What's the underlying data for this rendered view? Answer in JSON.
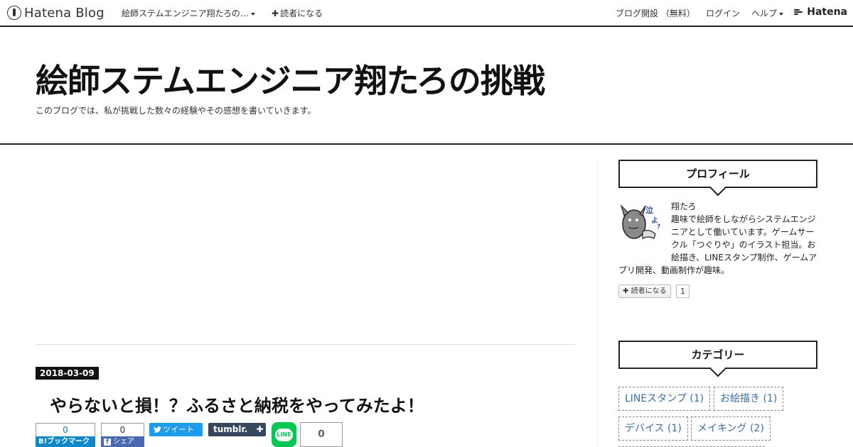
{
  "global_header": {
    "logo_text": "Hatena Blog",
    "blog_menu": "絵師ステムエンジニア翔たろの…",
    "subscribe": "読者になる",
    "open_blog": "ブログ開設 （無料）",
    "login": "ログイン",
    "help": "ヘルプ",
    "hatena": "Hatena"
  },
  "blog": {
    "title": "絵師ステムエンジニア翔たろの挑戦",
    "description": "このブログでは、私が挑戦した数々の経験やその感想を書いていきます。"
  },
  "entry": {
    "date": "2018-03-09",
    "title": "やらないと損！？ふるさと納税をやってみたよ！",
    "share": {
      "hatena_count": "0",
      "hatena_label": "B!ブックマーク",
      "facebook_count": "0",
      "facebook_label": "シェア",
      "facebook_icon": "f",
      "twitter_label": "ツイート",
      "tumblr_label": "tumblr.",
      "line_label": "LINE",
      "pocket_count": "0"
    }
  },
  "sidebar": {
    "profile": {
      "heading": "プロフィール",
      "name": "翔たろ",
      "bio": "趣味で絵師をしながらシステムエンジニアとして働いています。ゲームサークル「つぐりや」のイラスト担当。お絵描き、LINEスタンプ制作、ゲームアプリ開発、動画制作が趣味。",
      "subscribe_label": "読者になる",
      "subscribe_count": "1"
    },
    "categories": {
      "heading": "カテゴリー",
      "items": [
        {
          "label": "LINEスタンプ (1)"
        },
        {
          "label": "お絵描き (1)"
        },
        {
          "label": "デバイス (1)"
        },
        {
          "label": "メイキング (2)"
        }
      ]
    }
  },
  "colors": {
    "accent": "#222222",
    "hatena_blue": "#0f88c9",
    "facebook": "#4a68b1",
    "twitter": "#1c9cea",
    "tumblr": "#36465d",
    "line": "#06c755",
    "category_link": "#3b6fa0"
  }
}
